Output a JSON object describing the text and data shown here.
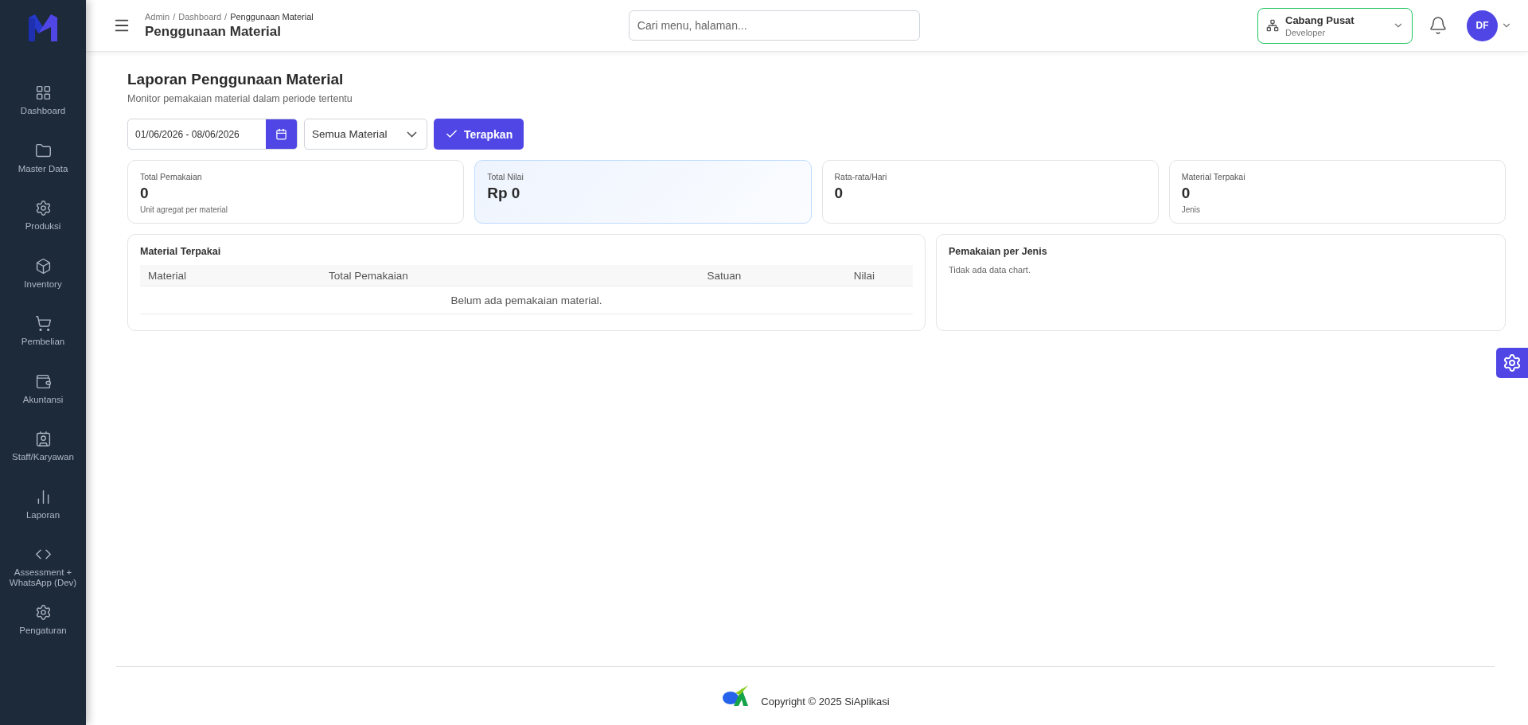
{
  "sidebar": {
    "items": [
      {
        "label": "Dashboard",
        "selected": false
      },
      {
        "label": "Master Data",
        "selected": false
      },
      {
        "label": "Produksi",
        "selected": false
      },
      {
        "label": "Inventory",
        "selected": false
      },
      {
        "label": "Pembelian",
        "selected": false
      },
      {
        "label": "Akuntansi",
        "selected": false
      },
      {
        "label": "Staff/Karyawan",
        "selected": false
      },
      {
        "label": "Laporan",
        "selected": false
      },
      {
        "label": "Assessment + WhatsApp (Dev)",
        "selected": false
      },
      {
        "label": "Pengaturan",
        "selected": false
      }
    ]
  },
  "header": {
    "breadcrumb": [
      "Admin",
      "Dashboard",
      "Penggunaan Material"
    ],
    "breadcrumb_separator": "/",
    "title": "Penggunaan Material",
    "search": {
      "placeholder": "Cari menu, halaman..."
    },
    "branch": {
      "name": "Cabang Pusat",
      "role": "Developer"
    },
    "avatar": "DF"
  },
  "page": {
    "title": "Laporan Penggunaan Material",
    "subtitle": "Monitor pemakaian material dalam periode tertentu",
    "filters": {
      "date_range": "01/06/2026 - 08/06/2026",
      "material": "Semua Material",
      "apply": "Terapkan"
    },
    "stats": [
      {
        "label": "Total Pemakaian",
        "value": "0",
        "note": "Unit agregat per material",
        "highlighted": false
      },
      {
        "label": "Total Nilai",
        "value": "Rp 0",
        "highlighted": true
      },
      {
        "label": "Rata-rata/Hari",
        "value": "0",
        "highlighted": false
      },
      {
        "label": "Material Terpakai",
        "value": "0",
        "note": "Jenis",
        "highlighted": false
      }
    ],
    "table": {
      "title": "Material Terpakai",
      "columns": [
        "Material",
        "Total Pemakaian",
        "Satuan",
        "Nilai"
      ],
      "empty": "Belum ada pemakaian material."
    },
    "chart_panel": {
      "title": "Pemakaian per Jenis",
      "empty": "Tidak ada data chart."
    }
  },
  "footer": {
    "copyright": "Copyright © 2025 SiAplikasi"
  }
}
